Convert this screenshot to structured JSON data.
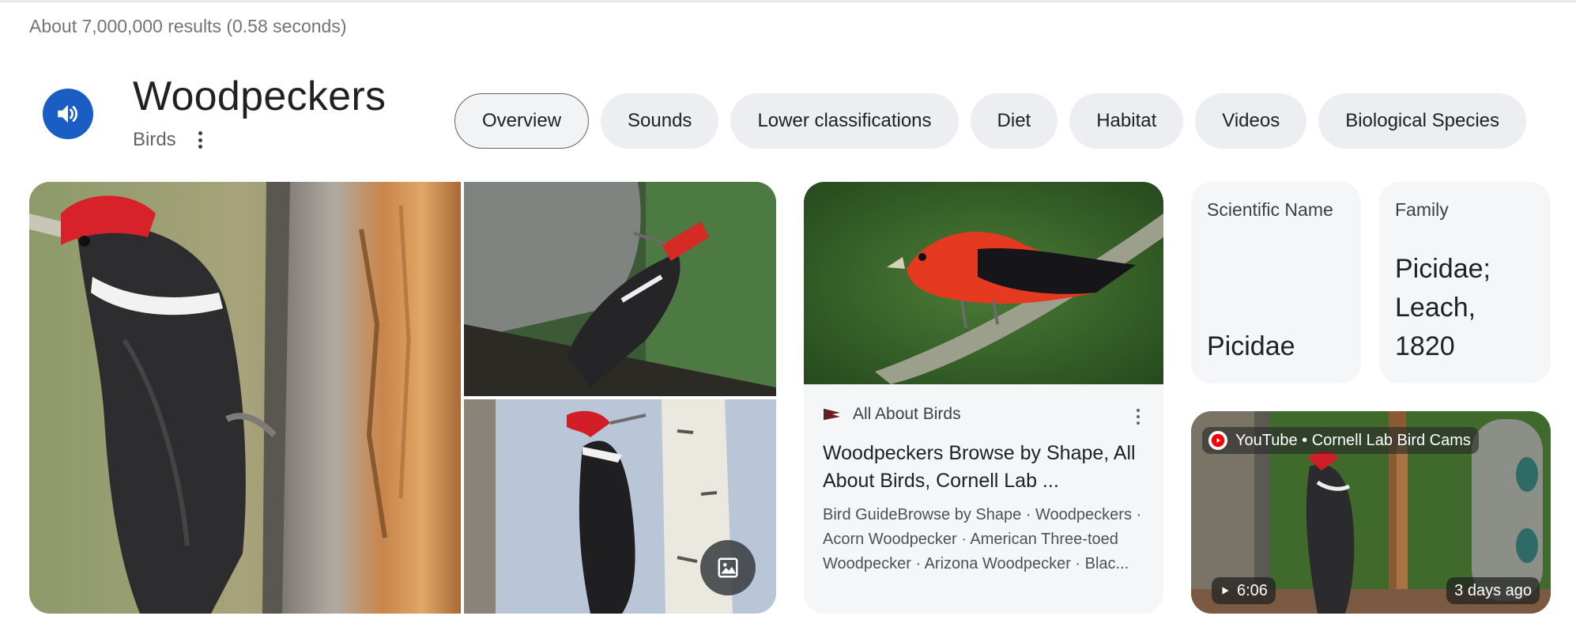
{
  "result_stats": "About 7,000,000 results (0.58 seconds)",
  "entity": {
    "title": "Woodpeckers",
    "subtitle": "Birds",
    "speaker_icon": "volume-icon",
    "more_icon": "vertical-dots-icon"
  },
  "chips": [
    {
      "label": "Overview",
      "active": true
    },
    {
      "label": "Sounds",
      "active": false
    },
    {
      "label": "Lower classifications",
      "active": false
    },
    {
      "label": "Diet",
      "active": false
    },
    {
      "label": "Habitat",
      "active": false
    },
    {
      "label": "Videos",
      "active": false
    },
    {
      "label": "Biological Species",
      "active": false
    }
  ],
  "images": {
    "main_alt": "Pileated woodpecker on tree trunk",
    "top_right_alt": "Pileated woodpecker on stump",
    "bottom_right_alt": "Pileated woodpecker on birch",
    "gallery_icon": "image-gallery-icon"
  },
  "article": {
    "source": "All About Birds",
    "title": "Woodpeckers Browse by Shape, All About Birds, Cornell Lab ...",
    "snippet": "Bird GuideBrowse by Shape · Woodpeckers · Acorn Woodpecker · American Three-toed Woodpecker · Arizona Woodpecker · Blac..."
  },
  "facts": [
    {
      "label": "Scientific Name",
      "value": "Picidae"
    },
    {
      "label": "Family",
      "value": "Picidae; Leach, 1820"
    }
  ],
  "video": {
    "source": "YouTube • Cornell Lab Bird Cams",
    "duration": "6:06",
    "age": "3 days ago"
  },
  "colors": {
    "accent_blue": "#1a5dc4",
    "chip_bg": "#eceef1",
    "card_bg": "#f5f6f8",
    "youtube_red": "#ff0000"
  }
}
